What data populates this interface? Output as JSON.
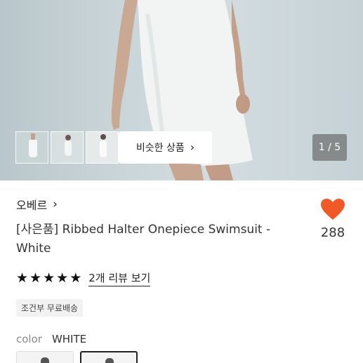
{
  "gallery": {
    "similar_label": "비슷한 상품",
    "pager": "1 / 5",
    "thumbnails": [
      "thumb-1",
      "thumb-2",
      "thumb-3"
    ]
  },
  "product": {
    "brand": "오베르",
    "title": "[사은품] Ribbed Halter Onepiece Swimsuit - White",
    "like_count": "288",
    "rating": 5,
    "review_link": "2개 리뷰 보기",
    "shipping_badge": "조건부 무료배송",
    "color_label": "color",
    "color_value": "WHITE"
  },
  "colors": {
    "heart": "#f05a28",
    "accent": "#222222"
  }
}
